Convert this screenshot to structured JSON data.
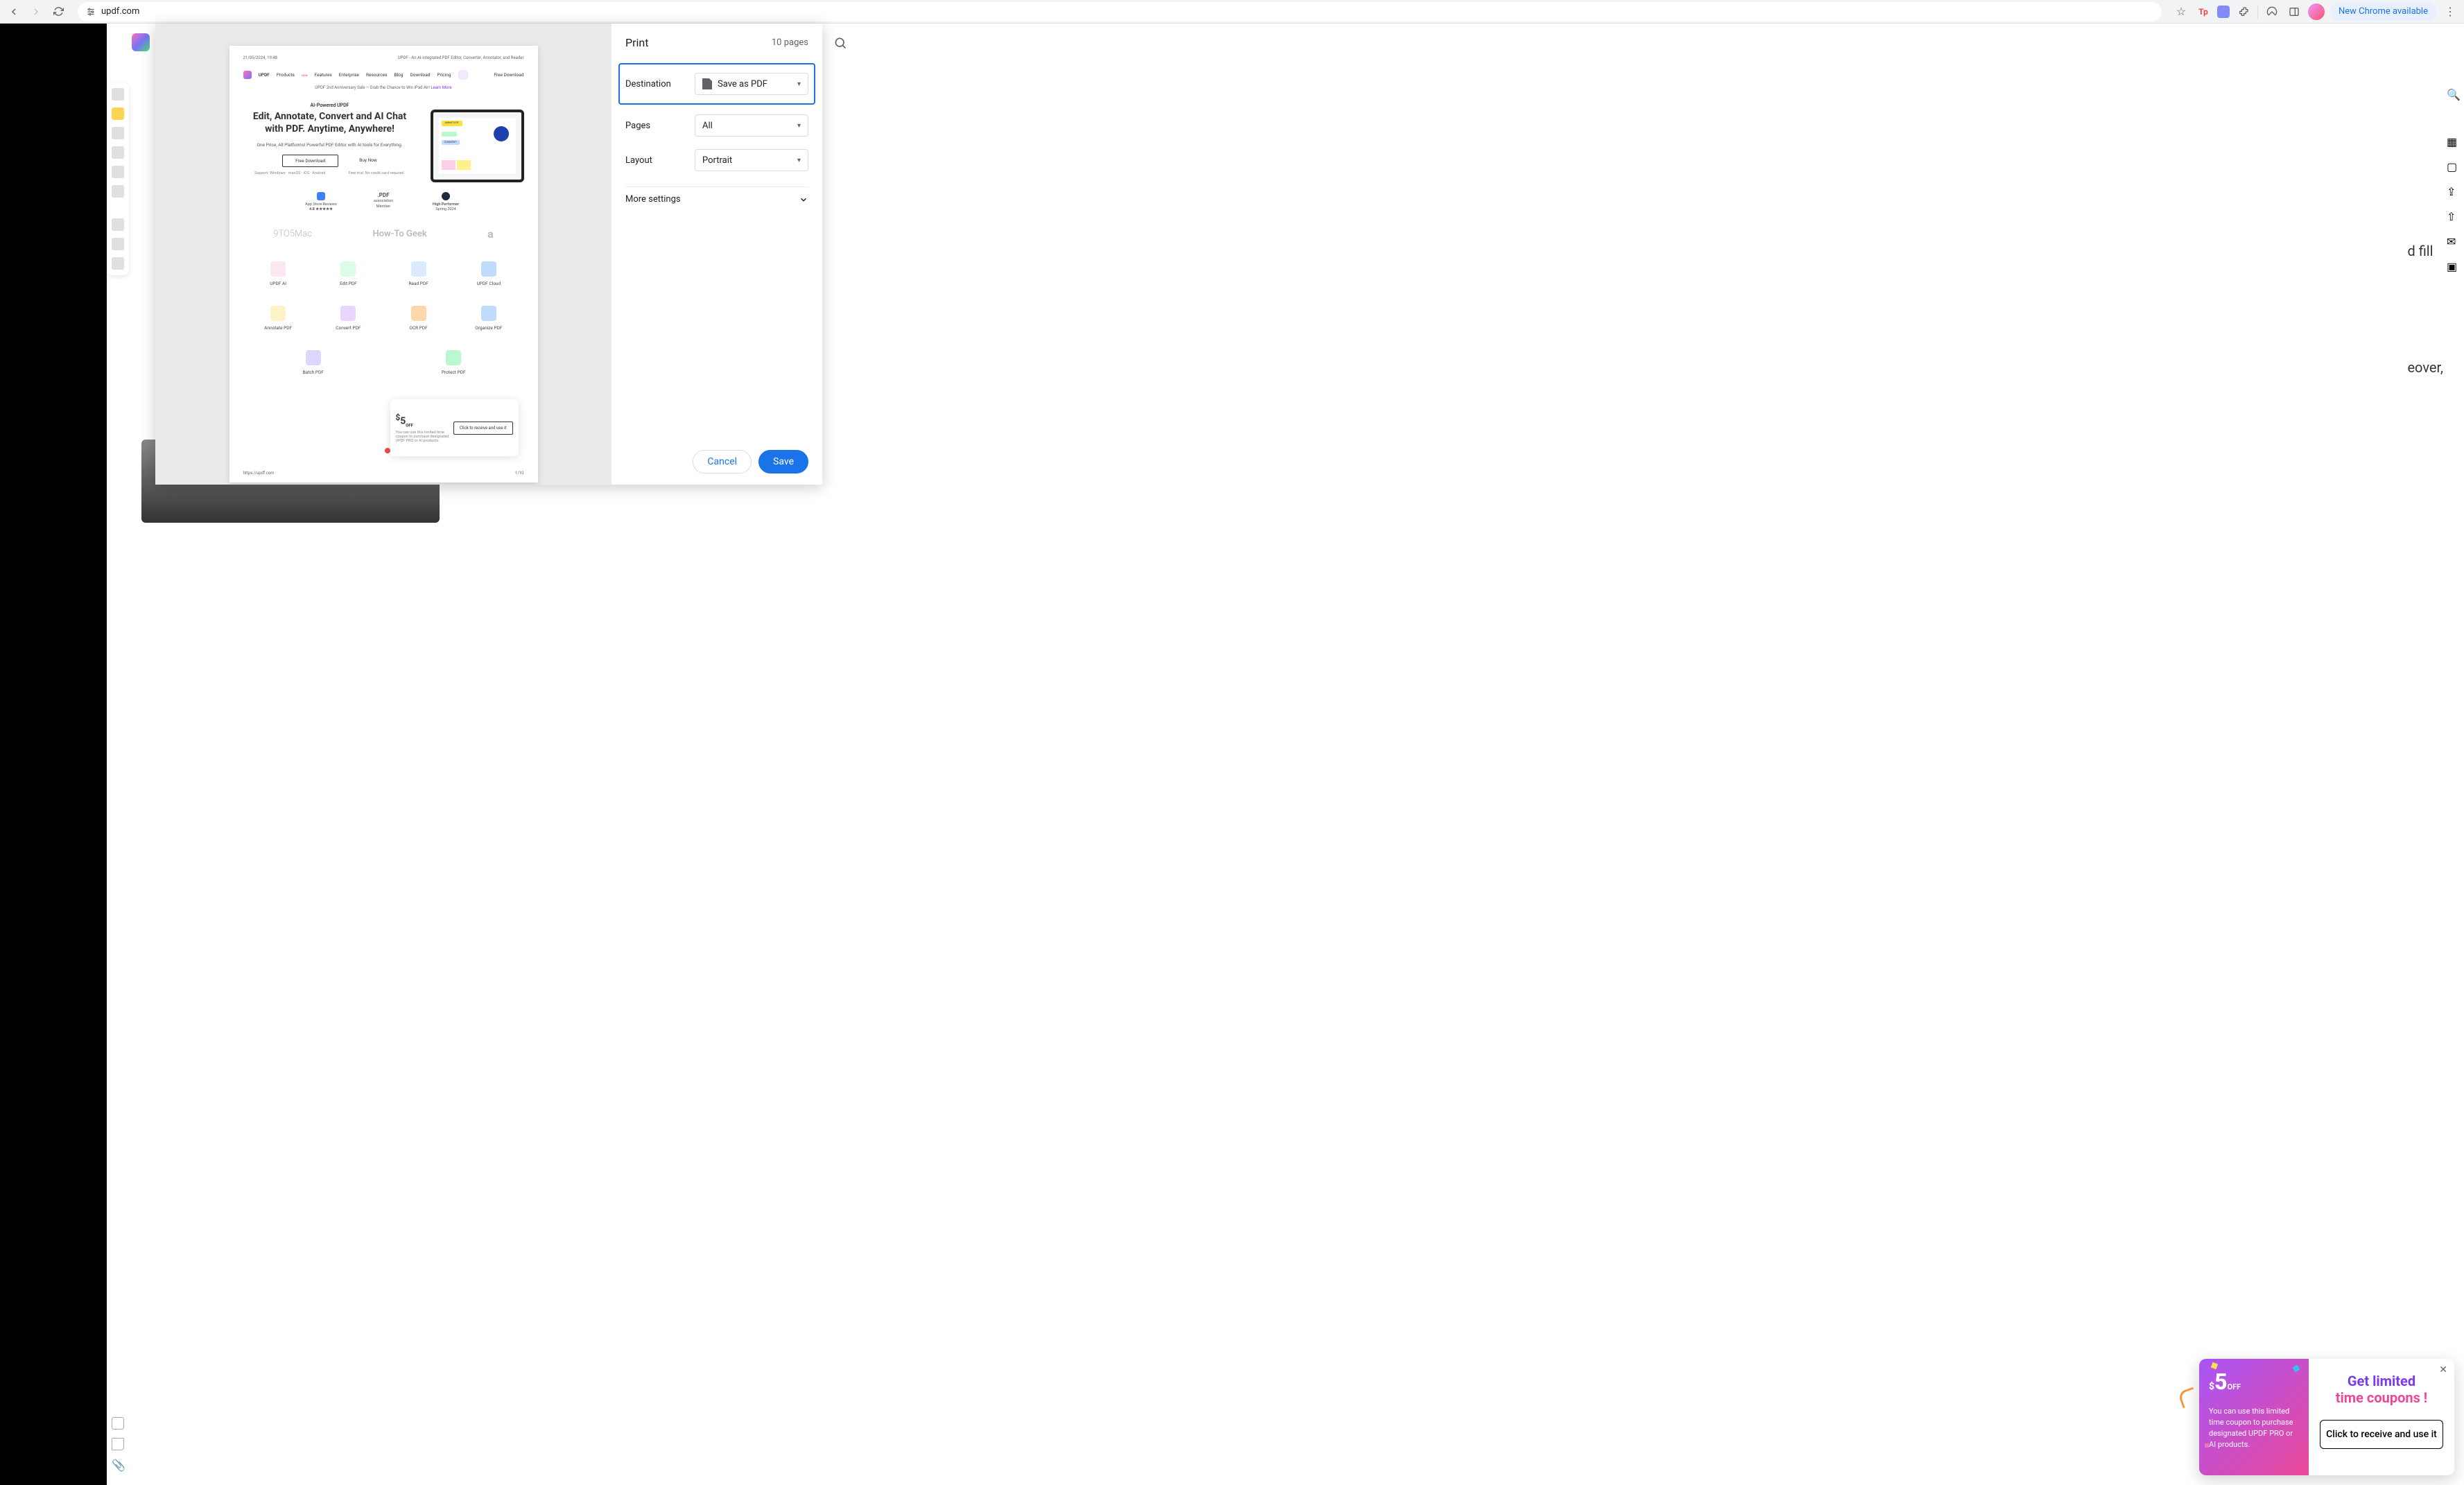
{
  "browser": {
    "url": "updf.com",
    "new_chrome": "New Chrome available"
  },
  "print": {
    "title": "Print",
    "page_count": "10 pages",
    "destination_label": "Destination",
    "destination_value": "Save as PDF",
    "pages_label": "Pages",
    "pages_value": "All",
    "layout_label": "Layout",
    "layout_value": "Portrait",
    "more_settings": "More settings",
    "cancel": "Cancel",
    "save": "Save"
  },
  "preview": {
    "timestamp": "21/05/2024, 19:48",
    "doc_title": "UPDF - An AI-integrated PDF Editor, Converter, Annotator, and Reader",
    "brand": "UPDF",
    "nav": [
      "Products",
      "Features",
      "Enterprise",
      "Resources",
      "Blog",
      "Download",
      "Pricing"
    ],
    "nav_new": "NEW",
    "free_dl_link": "Free Download",
    "banner_text": "UPDF 2nd Anniversary Sale – Grab the Chance to Win iPad Air! ",
    "banner_link": "Learn More",
    "ai_tag": "AI-Powered UPDF",
    "hero_title": "Edit, Annotate, Convert and AI Chat with PDF. Anytime, Anywhere!",
    "hero_sub": "One Price, All Platforms! Powerful PDF Editor with AI tools for Everything.",
    "btn_free": "Free Download",
    "btn_buy": "Buy Now",
    "support_left": "Support: Windows · macOS · iOS · Android",
    "support_right": "Free trial. No credit card required.",
    "badge1_t": "App Store Reviews",
    "badge1_b": "4.8 ★★★★★",
    "badge2_t": ".PDF",
    "badge2_m": "association",
    "badge2_b": "Member",
    "badge3_t": "High Performer",
    "badge3_b": "Spring 2024",
    "press1": "9TO5Mac",
    "press2": "How-To Geek",
    "features": [
      [
        "UPDF AI",
        "Edit PDF",
        "Read PDF",
        "UPDF Cloud"
      ],
      [
        "Annotate PDF",
        "Convert PDF",
        "OCR PDF",
        "Organize PDF"
      ],
      [
        "Batch PDF",
        "Protect PDF"
      ]
    ],
    "feature_colors": [
      [
        "#fce7f3",
        "#dcfce7",
        "#dbeafe",
        "#bfdbfe"
      ],
      [
        "#fef3c7",
        "#e9d5ff",
        "#fed7aa",
        "#bfdbfe"
      ],
      [
        "#ddd6fe",
        "#bbf7d0"
      ]
    ],
    "coupon_5_pre": "$",
    "coupon_5": "5",
    "coupon_5_suf": "OFF",
    "coupon_text": "You can use this limited time coupon to purchase designated UPDF PRO or AI products.",
    "coupon_btn": "Click to receive and use it",
    "footer_url": "https://updf.com",
    "footer_page": "1/10"
  },
  "bg": {
    "text_lines": "d fill\n\n\neover,"
  },
  "promo": {
    "five_pre": "$",
    "five": "5",
    "five_suf": "OFF",
    "text": "You can use this limited time coupon to purchase designated UPDF PRO or AI products.",
    "title_l1": "Get limited",
    "title_l2": "time coupons !",
    "btn": "Click to receive and use it"
  }
}
